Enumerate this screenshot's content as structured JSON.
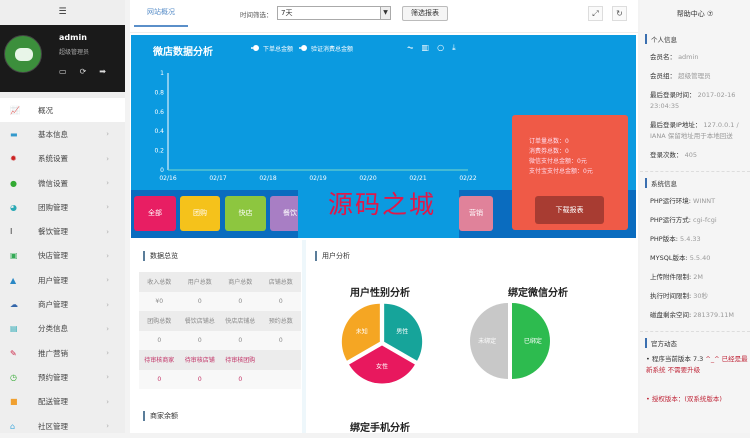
{
  "sidebar": {
    "toggle": "☰",
    "user": {
      "name": "admin",
      "role": "超级管理员"
    },
    "items": [
      {
        "label": "概况",
        "icon": "📈",
        "color": "#5577aa"
      },
      {
        "label": "基本信息",
        "icon": "▬",
        "color": "#3399cc"
      },
      {
        "label": "系统设置",
        "icon": "✹",
        "color": "#cc2222"
      },
      {
        "label": "微信设置",
        "icon": "●",
        "color": "#33aa33"
      },
      {
        "label": "团购管理",
        "icon": "◕",
        "color": "#2aa9b5"
      },
      {
        "label": "餐饮管理",
        "icon": "Ⅰ",
        "color": "#333"
      },
      {
        "label": "快店管理",
        "icon": "▣",
        "color": "#33aa55"
      },
      {
        "label": "用户管理",
        "icon": "▲",
        "color": "#2a88c5"
      },
      {
        "label": "商户管理",
        "icon": "☁",
        "color": "#3366aa"
      },
      {
        "label": "分类信息",
        "icon": "▤",
        "color": "#2aa9b5"
      },
      {
        "label": "推广营销",
        "icon": "✎",
        "color": "#cc2244"
      },
      {
        "label": "预约管理",
        "icon": "◷",
        "color": "#33aa33"
      },
      {
        "label": "配送管理",
        "icon": "■",
        "color": "#f0a030"
      },
      {
        "label": "社区管理",
        "icon": "⌂",
        "color": "#44aadd"
      }
    ],
    "arrow": "›"
  },
  "main": {
    "tab": "网站概况",
    "filter_label": "时间筛选：",
    "filter_value": "7天",
    "filter_button": "筛选报表",
    "chart_panel": {
      "title": "微店数据分析",
      "legend": [
        "下单总金额",
        "验证消费总金额"
      ],
      "categories": [
        {
          "label": "全部",
          "color": "#e81e63"
        },
        {
          "label": "团购",
          "color": "#f5c21b"
        },
        {
          "label": "快店",
          "color": "#8dc63f"
        },
        {
          "label": "餐饮",
          "color": "#a87ec4"
        },
        {
          "label": "营销",
          "color": "#e0829a"
        }
      ],
      "summary": [
        "订单量总数：0",
        "消费券总数：0",
        "微信支付总金额：0元",
        "支付宝支付总金额：0元"
      ],
      "download": "下载报表",
      "watermark": "源码之城"
    },
    "stats": {
      "title": "数据总览",
      "rows": [
        [
          "收入总数",
          "用户总数",
          "商户总数",
          "店铺总数"
        ],
        [
          "¥0",
          "0",
          "0",
          "0"
        ],
        [
          "团购总数",
          "餐饮店铺总",
          "快店店铺总",
          "预约总数"
        ],
        [
          "0",
          "0",
          "0",
          "0"
        ],
        [
          "待审核商家",
          "待审核店铺",
          "待审核团购",
          ""
        ],
        [
          "0",
          "0",
          "0",
          ""
        ]
      ],
      "balance_title": "商家余额"
    },
    "user_analysis": {
      "title": "用户分析",
      "gender_title": "用户性别分析",
      "wechat_title": "绑定微信分析",
      "phone_title": "绑定手机分析"
    }
  },
  "chart_data": {
    "type": "line",
    "title": "微店数据分析",
    "x": [
      "02/16",
      "02/17",
      "02/18",
      "02/19",
      "02/20",
      "02/21",
      "02/22"
    ],
    "series": [
      {
        "name": "下单总金额",
        "values": [
          0,
          0,
          0,
          0,
          0,
          0,
          0
        ]
      },
      {
        "name": "验证消费总金额",
        "values": [
          0,
          0,
          0,
          0,
          0,
          0,
          0
        ]
      }
    ],
    "yticks": [
      "0",
      "0.2",
      "0.4",
      "0.6",
      "0.8",
      "1"
    ],
    "ylim": [
      0,
      1
    ]
  },
  "pies": {
    "gender": [
      {
        "label": "未知",
        "value": 1,
        "color": "#f5a623"
      },
      {
        "label": "男性",
        "value": 1,
        "color": "#16a49a"
      },
      {
        "label": "女性",
        "value": 1,
        "color": "#e8185e"
      }
    ],
    "wechat": [
      {
        "label": "未绑定",
        "value": 1,
        "color": "#c8c8c8"
      },
      {
        "label": "已绑定",
        "value": 1,
        "color": "#2dbb4f"
      }
    ]
  },
  "right": {
    "help": "帮助中心 ⑦",
    "personal_title": "个人信息",
    "personal": [
      {
        "k": "会员名：",
        "v": "admin"
      },
      {
        "k": "会员组：",
        "v": "超级管理员"
      },
      {
        "k": "最后登录时间：",
        "v": "2017-02-16 23:04:35"
      },
      {
        "k": "最后登录IP地址：",
        "v": "127.0.0.1 / IANA 保留地址用于本地回送"
      },
      {
        "k": "登录次数：",
        "v": "405"
      }
    ],
    "system_title": "系统信息",
    "system": [
      {
        "k": "PHP运行环境:",
        "v": "WINNT"
      },
      {
        "k": "PHP运行方式:",
        "v": "cgi-fcgi"
      },
      {
        "k": "PHP版本:",
        "v": "5.4.33"
      },
      {
        "k": "MYSQL版本:",
        "v": "5.5.40"
      },
      {
        "k": "上传附件限制:",
        "v": "2M"
      },
      {
        "k": "执行时间限制:",
        "v": "30秒"
      },
      {
        "k": "磁盘剩余空间:",
        "v": "281379.11M"
      }
    ],
    "news_title": "官方动态",
    "news1": "• 程序当前版本 7.3",
    "news1b": "^_^ 已经是最新系统 不需要升级",
    "news2": "• 授权版本：(双系统版本)"
  }
}
